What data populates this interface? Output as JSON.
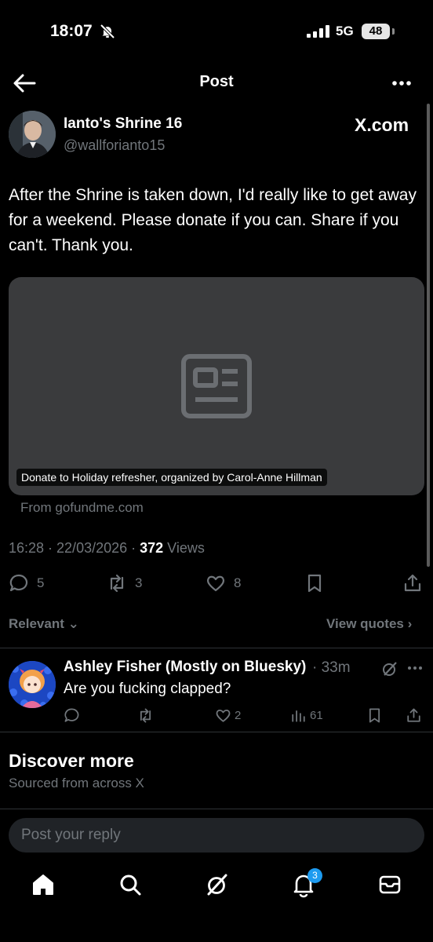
{
  "status_bar": {
    "time": "18:07",
    "network": "5G",
    "battery": "48"
  },
  "header": {
    "title": "Post"
  },
  "post": {
    "author_name": "Ianto's Shrine 16",
    "author_handle": "@wallforianto15",
    "source_label": "X.com",
    "text": "After the Shrine is taken down, I'd really like to get away for a weekend. Please donate if you can. Share if you can't. Thank you.",
    "card": {
      "caption": "Donate to Holiday refresher, organized by Carol-Anne Hillman",
      "domain": "From gofundme.com"
    },
    "timestamp": "16:28 · 22/03/2026 · ",
    "views_count": "372",
    "views_label": " Views",
    "stats": {
      "replies": "5",
      "reposts": "3",
      "likes": "8"
    }
  },
  "filters": {
    "sort_label": "Relevant",
    "view_quotes": "View quotes"
  },
  "reply": {
    "author_name": "Ashley Fisher (Mostly on Bluesky)",
    "time": "· 33m",
    "text": "Are you fucking clapped?",
    "likes": "2",
    "views": "61"
  },
  "discover": {
    "title": "Discover more",
    "subtitle": "Sourced from across X"
  },
  "composer": {
    "placeholder": "Post your reply"
  },
  "bottom_nav": {
    "notification_count": "3"
  },
  "colors": {
    "background": "#000000",
    "muted": "#71767b",
    "accent": "#1d9bf0",
    "card": "#3a3b3d"
  }
}
